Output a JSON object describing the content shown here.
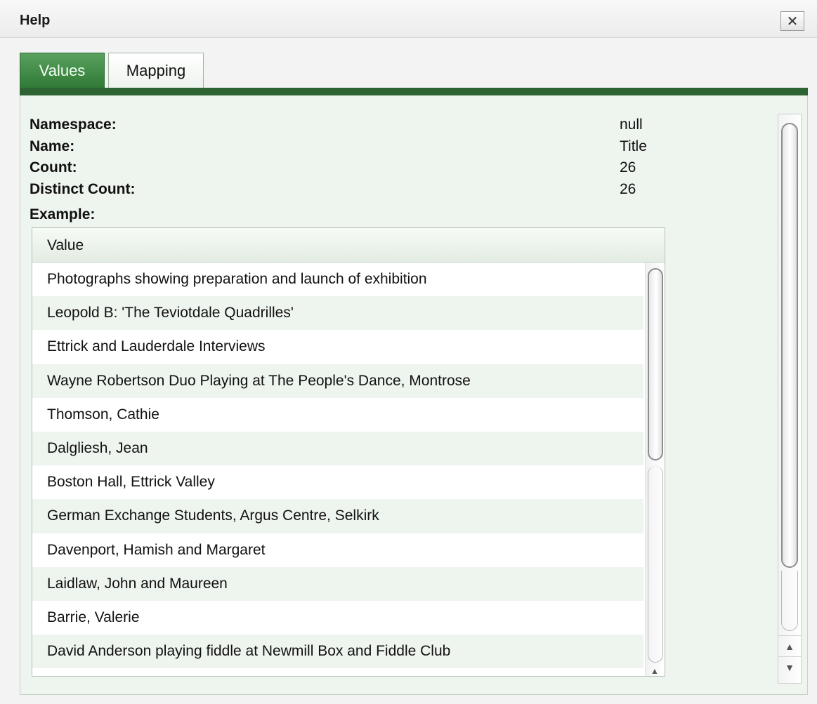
{
  "window": {
    "title": "Help",
    "close_glyph": "✕"
  },
  "tabs": [
    {
      "label": "Values",
      "active": true
    },
    {
      "label": "Mapping",
      "active": false
    }
  ],
  "meta": {
    "namespace_label": "Namespace:",
    "namespace_value": "null",
    "name_label": "Name:",
    "name_value": "Title",
    "count_label": "Count:",
    "count_value": "26",
    "distinct_label": "Distinct Count:",
    "distinct_value": "26",
    "example_label": "Example:"
  },
  "table": {
    "header": "Value",
    "rows": [
      "Photographs showing preparation and launch of exhibition",
      "Leopold B: 'The Teviotdale Quadrilles'",
      "Ettrick and Lauderdale Interviews",
      "Wayne Robertson Duo Playing at The People's Dance, Montrose",
      "Thomson, Cathie",
      "Dalgliesh, Jean",
      "Boston Hall, Ettrick Valley",
      "German Exchange Students, Argus Centre, Selkirk",
      "Davenport, Hamish and Margaret",
      "Laidlaw, John and Maureen",
      "Barrie, Valerie",
      "David Anderson playing fiddle at Newmill Box and Fiddle Club"
    ]
  },
  "scroll": {
    "up_glyph": "▲",
    "down_glyph": "▼"
  },
  "colors": {
    "accent_green": "#2e6434",
    "tab_active": "#3f8a45",
    "row_alt": "#eef4ee"
  }
}
